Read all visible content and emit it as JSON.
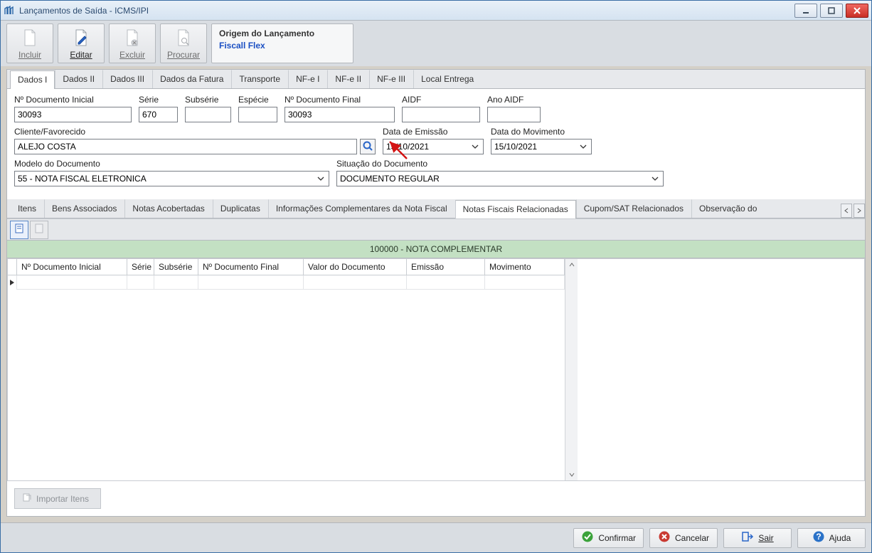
{
  "window": {
    "title": "Lançamentos de Saída - ICMS/IPI"
  },
  "toolbar": {
    "incluir": "Incluir",
    "editar": "Editar",
    "excluir": "Excluir",
    "procurar": "Procurar"
  },
  "origin": {
    "header": "Origem do Lançamento",
    "value": "Fiscall Flex"
  },
  "tabs": [
    {
      "label": "Dados I",
      "active": true
    },
    {
      "label": "Dados II"
    },
    {
      "label": "Dados III"
    },
    {
      "label": "Dados da Fatura"
    },
    {
      "label": "Transporte"
    },
    {
      "label": "NF-e I"
    },
    {
      "label": "NF-e II"
    },
    {
      "label": "NF-e III"
    },
    {
      "label": "Local Entrega"
    }
  ],
  "form": {
    "n_doc_inicial": {
      "label": "Nº Documento Inicial",
      "value": "30093"
    },
    "serie": {
      "label": "Série",
      "value": "670"
    },
    "subserie": {
      "label": "Subsérie",
      "value": ""
    },
    "especie": {
      "label": "Espécie",
      "value": ""
    },
    "n_doc_final": {
      "label": "Nº Documento Final",
      "value": "30093"
    },
    "aidf": {
      "label": "AIDF",
      "value": ""
    },
    "ano_aidf": {
      "label": "Ano AIDF",
      "value": ""
    },
    "cliente": {
      "label": "Cliente/Favorecido",
      "value": "ALEJO COSTA"
    },
    "data_emissao": {
      "label": "Data de Emissão",
      "value": "15/10/2021"
    },
    "data_movimento": {
      "label": "Data do Movimento",
      "value": "15/10/2021"
    },
    "modelo": {
      "label": "Modelo do Documento",
      "value": "55 - NOTA FISCAL ELETRONICA"
    },
    "situacao": {
      "label": "Situação do Documento",
      "value": "DOCUMENTO REGULAR"
    }
  },
  "subtabs": [
    {
      "label": "Itens"
    },
    {
      "label": "Bens Associados"
    },
    {
      "label": "Notas Acobertadas"
    },
    {
      "label": "Duplicatas"
    },
    {
      "label": "Informações Complementares da Nota Fiscal"
    },
    {
      "label": "Notas Fiscais Relacionadas",
      "active": true
    },
    {
      "label": "Cupom/SAT Relacionados"
    },
    {
      "label": "Observação do"
    }
  ],
  "banner": "100000   -   NOTA COMPLEMENTAR",
  "grid": {
    "columns": [
      "Nº Documento Inicial",
      "Série",
      "Subsérie",
      "Nº Documento Final",
      "Valor do Documento",
      "Emissão",
      "Movimento"
    ],
    "rows": [
      {
        "n_doc_inicial": "",
        "serie": "",
        "subserie": "",
        "n_doc_final": "",
        "valor": "",
        "emissao": "",
        "movimento": ""
      }
    ]
  },
  "import_button": "Importar Itens",
  "footer": {
    "confirmar": "Confirmar",
    "cancelar": "Cancelar",
    "sair": "Sair",
    "ajuda": "Ajuda"
  }
}
